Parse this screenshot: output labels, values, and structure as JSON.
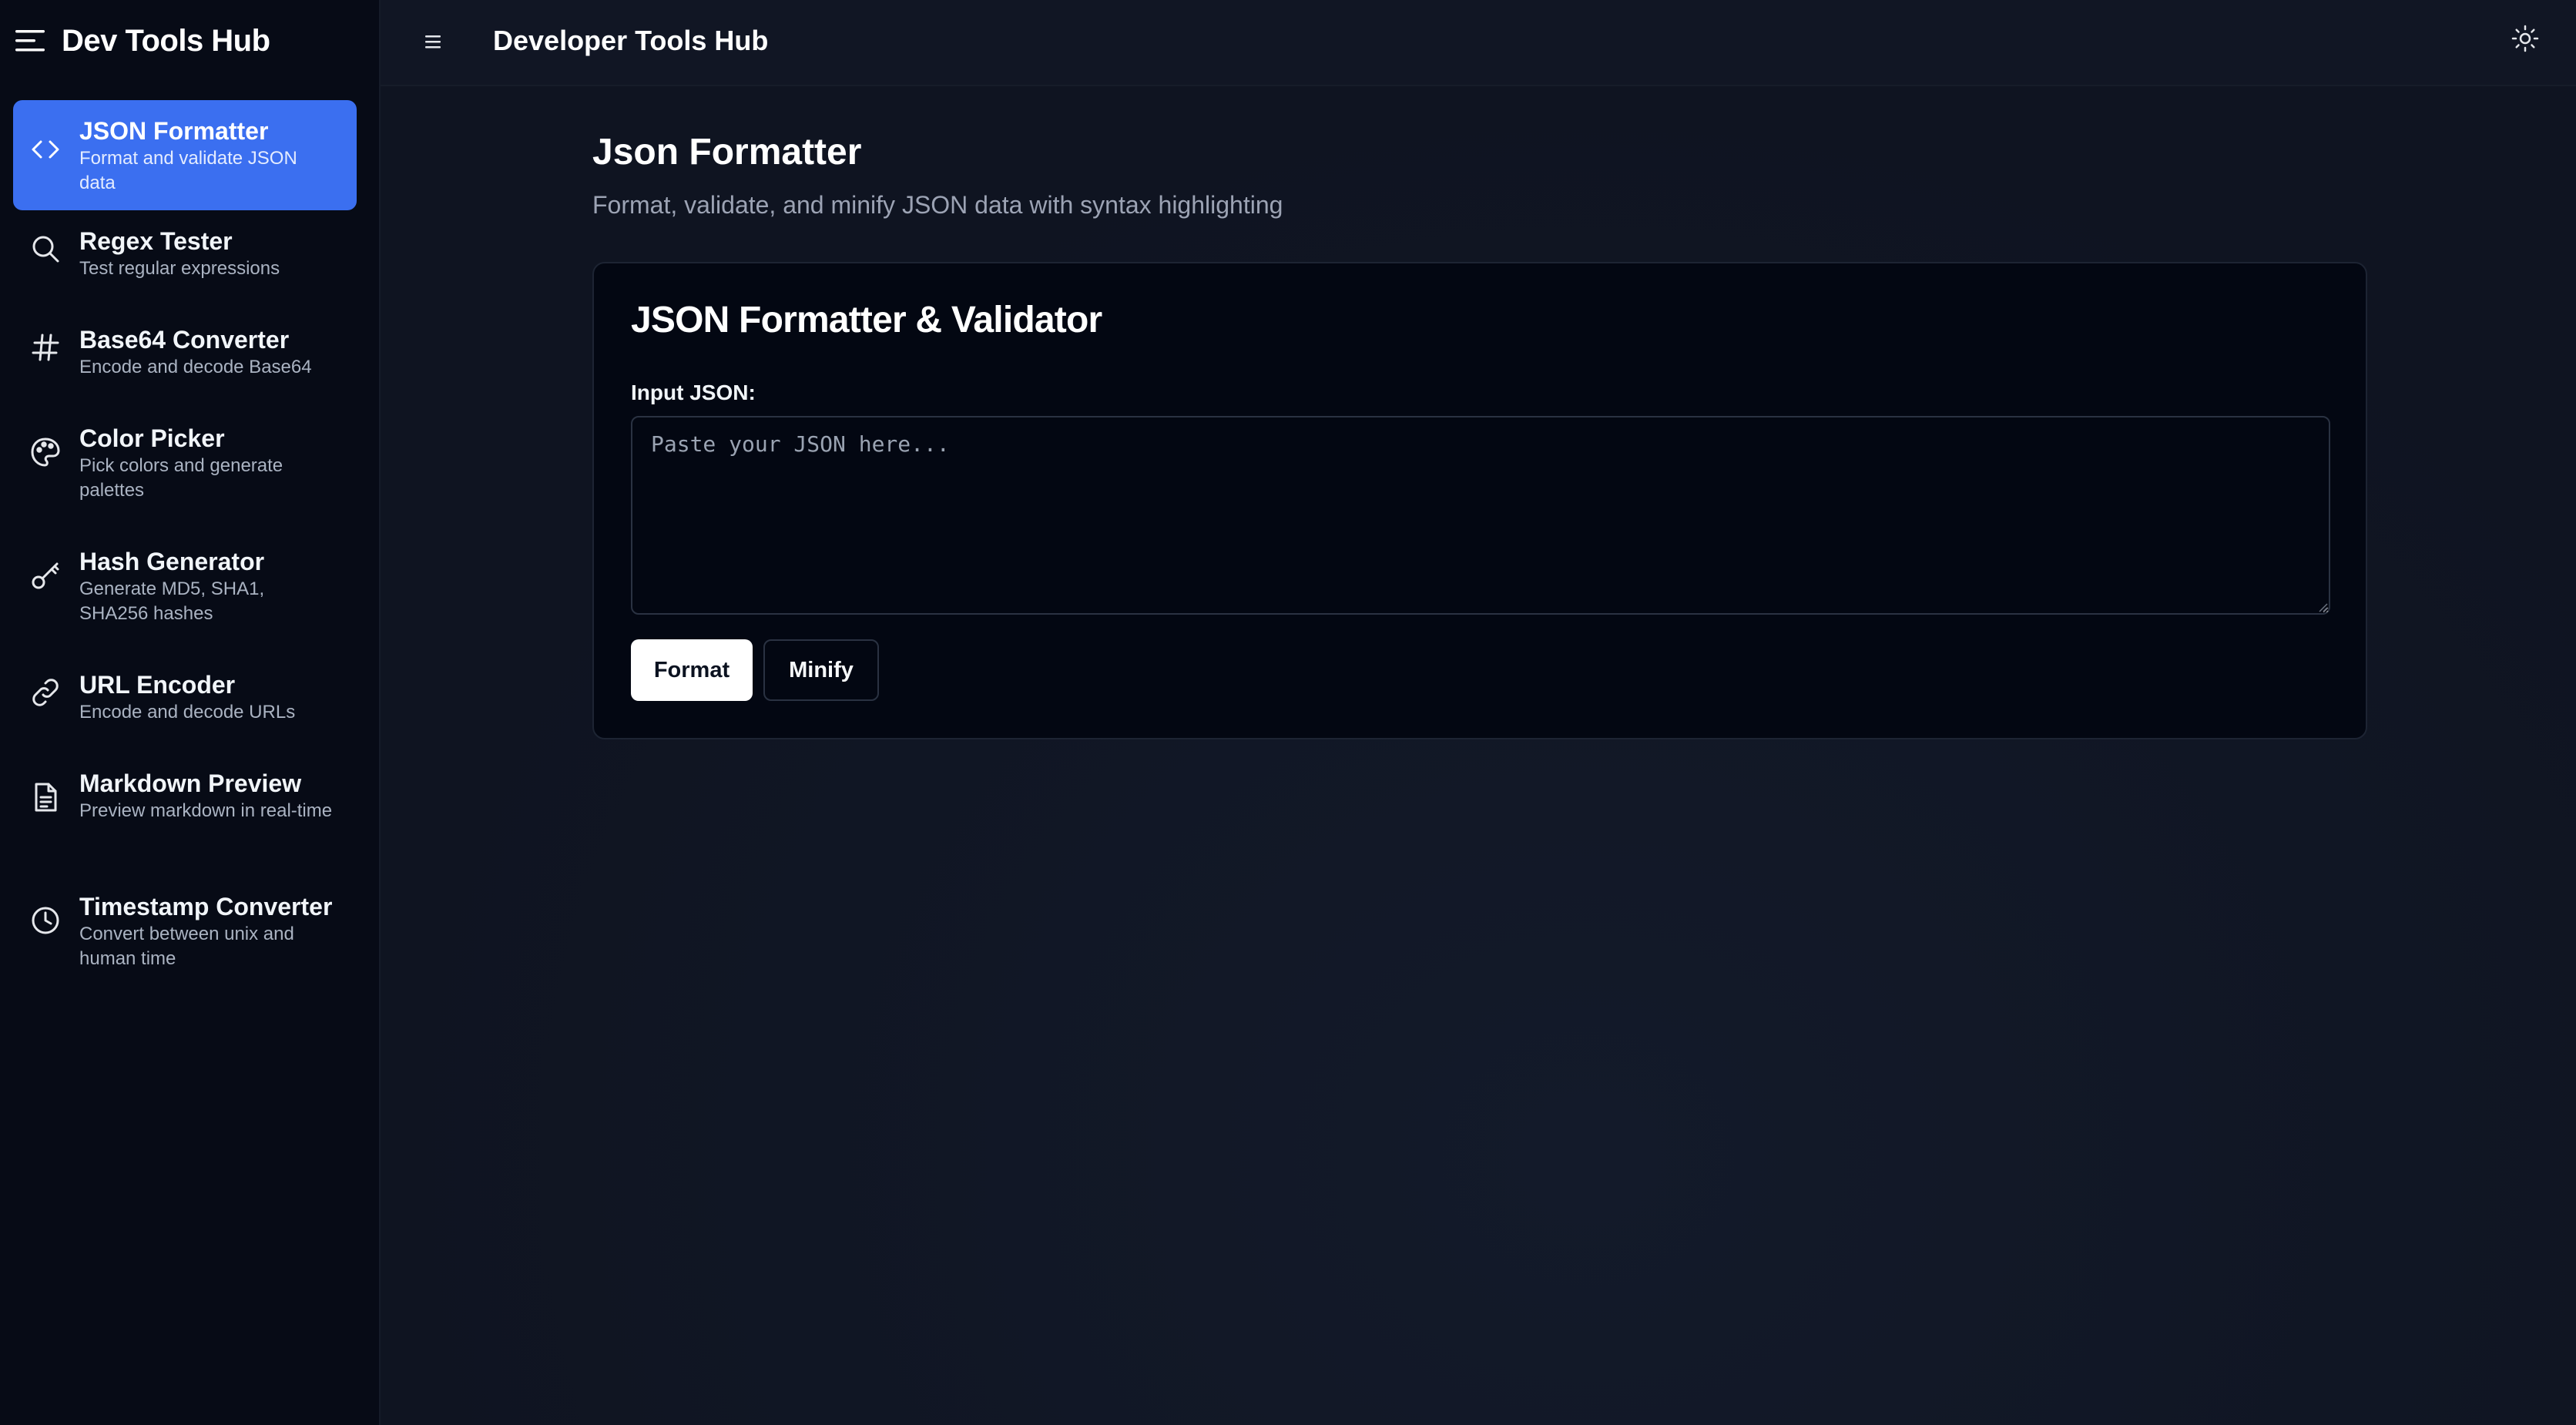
{
  "app": {
    "brand_title": "Dev Tools Hub",
    "header_title": "Developer Tools Hub"
  },
  "sidebar": {
    "items": [
      {
        "title": "JSON Formatter",
        "desc": "Format and validate JSON data",
        "icon": "code-icon",
        "active": true
      },
      {
        "title": "Regex Tester",
        "desc": "Test regular expressions",
        "icon": "search-icon",
        "active": false
      },
      {
        "title": "Base64 Converter",
        "desc": "Encode and decode Base64",
        "icon": "hash-icon",
        "active": false
      },
      {
        "title": "Color Picker",
        "desc": "Pick colors and generate palettes",
        "icon": "palette-icon",
        "active": false
      },
      {
        "title": "Hash Generator",
        "desc": "Generate MD5, SHA1, SHA256 hashes",
        "icon": "key-icon",
        "active": false
      },
      {
        "title": "URL Encoder",
        "desc": "Encode and decode URLs",
        "icon": "link-icon",
        "active": false
      },
      {
        "title": "Markdown Preview",
        "desc": "Preview markdown in real-time",
        "icon": "file-text-icon",
        "active": false
      },
      {
        "title": "Timestamp Converter",
        "desc": "Convert between unix and human time",
        "icon": "clock-icon",
        "active": false
      }
    ]
  },
  "main": {
    "page_title": "Json Formatter",
    "page_subtitle": "Format, validate, and minify JSON data with syntax highlighting",
    "card": {
      "title": "JSON Formatter & Validator",
      "input_label": "Input JSON:",
      "input_value": "",
      "input_placeholder": "Paste your JSON here...",
      "format_label": "Format",
      "minify_label": "Minify"
    }
  },
  "colors": {
    "accent": "#3b6ff0",
    "sidebar_bg": "#070b16",
    "main_bg": "#0f1420",
    "card_bg": "#030712"
  }
}
